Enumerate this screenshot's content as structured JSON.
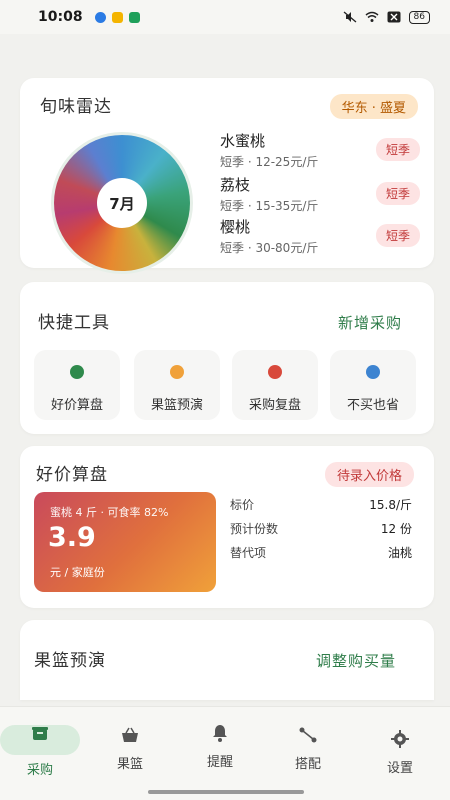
{
  "status_bar": {
    "time": "10:08",
    "battery": "86",
    "icons": [
      "mute-icon",
      "wifi-icon",
      "close-box-icon"
    ]
  },
  "radar": {
    "title": "旬味雷达",
    "region": "华东 · 盛夏",
    "month": "7月",
    "fruits": [
      {
        "name": "水蜜桃",
        "detail": "短季 · 12-25元/斤",
        "season": "短季"
      },
      {
        "name": "荔枝",
        "detail": "短季 · 15-35元/斤",
        "season": "短季"
      },
      {
        "name": "樱桃",
        "detail": "短季 · 30-80元/斤",
        "season": "短季"
      }
    ]
  },
  "tools": {
    "title": "快捷工具",
    "action": "新增采购",
    "items": [
      {
        "label": "好价算盘",
        "color": "#2f8a4c"
      },
      {
        "label": "果篮预演",
        "color": "#f0a13a"
      },
      {
        "label": "采购复盘",
        "color": "#d8493b"
      },
      {
        "label": "不买也省",
        "color": "#3d84d1"
      }
    ]
  },
  "calc": {
    "title": "好价算盘",
    "badge": "待录入价格",
    "summary": "蜜桃 4 斤 · 可食率 82%",
    "value": "3.9",
    "unit": "元 / 家庭份",
    "rows": [
      {
        "key": "标价",
        "value": "15.8/斤"
      },
      {
        "key": "预计份数",
        "value": "12 份"
      },
      {
        "key": "替代项",
        "value": "油桃"
      }
    ]
  },
  "basket": {
    "title": "果篮预演",
    "action": "调整购买量"
  },
  "nav": {
    "items": [
      {
        "label": "采购",
        "icon": "basket-icon"
      },
      {
        "label": "果篮",
        "icon": "bag-icon"
      },
      {
        "label": "提醒",
        "icon": "bell-icon"
      },
      {
        "label": "搭配",
        "icon": "share-icon"
      },
      {
        "label": "设置",
        "icon": "gear-icon"
      }
    ],
    "active": "采购"
  },
  "colors": {
    "accent_green": "#2f7d4a",
    "badge_red": "#c23a3a",
    "badge_orange": "#b35a00"
  }
}
